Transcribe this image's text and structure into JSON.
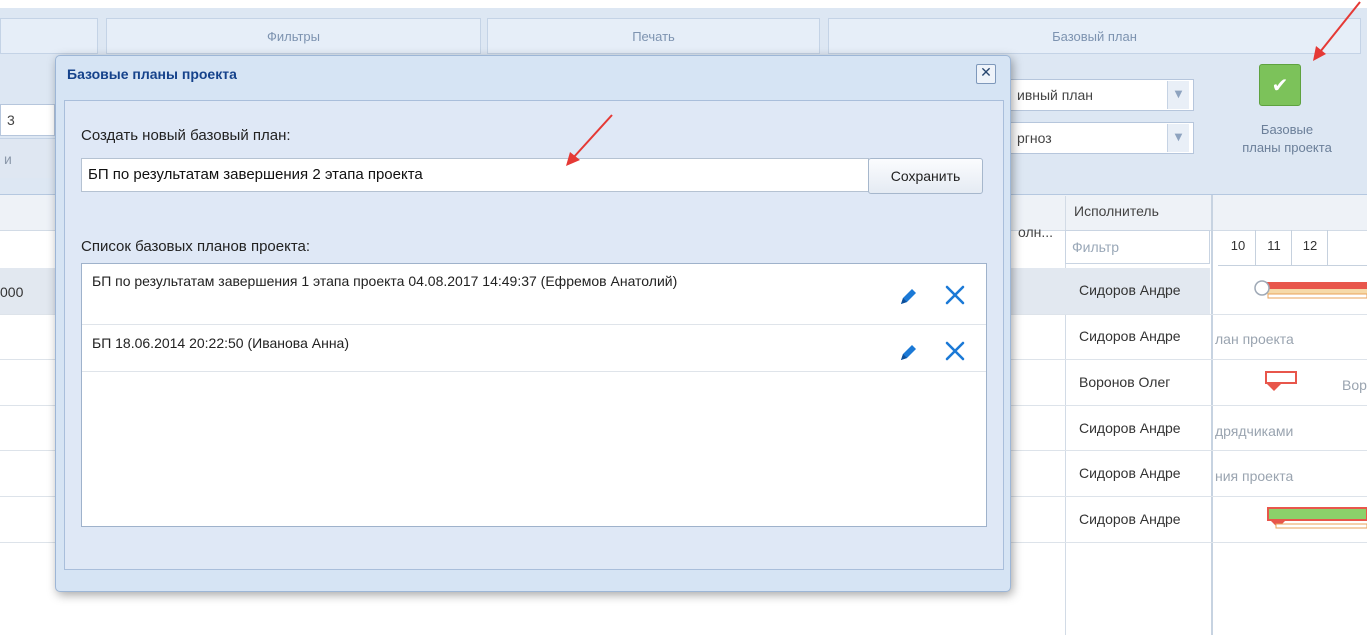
{
  "ribbon": {
    "tabs": [
      "Фильтры",
      "Печать",
      "Базовый план"
    ],
    "left_field_value": "3",
    "left_field_sub": "и",
    "plan_select": "ивный план",
    "forecast_select": "ргноз",
    "baselines_button": {
      "line1": "Базовые",
      "line2": "планы проекта"
    }
  },
  "grid": {
    "row_stub": "000",
    "completion_header": "олн...",
    "performer_header": "Исполнитель",
    "filter_placeholder": "Фильтр",
    "days": [
      "10",
      "11",
      "12"
    ],
    "performers": [
      "Сидоров Андре",
      "Сидоров Андре",
      "Воронов Олег",
      "Сидоров Андре",
      "Сидоров Андре",
      "Сидоров Андре"
    ],
    "gantt_texts": [
      "лан проекта",
      "Вор",
      "дрядчиками",
      "ния проекта"
    ]
  },
  "dialog": {
    "title": "Базовые планы проекта",
    "close_glyph": "✕",
    "create_label": "Создать новый базовый план:",
    "new_name_value": "БП по результатам завершения 2 этапа проекта",
    "save_label": "Сохранить",
    "list_label": "Список базовых планов проекта:",
    "baselines": [
      "БП по результатам завершения 1 этапа проекта 04.08.2017 14:49:37 (Ефремов Анатолий)",
      "БП 18.06.2014 20:22:50 (Иванова Анна)"
    ]
  },
  "colors": {
    "accent_blue": "#15428b",
    "dialog_bg": "#dfe8f6",
    "icon_blue": "#1b79d6",
    "success_green": "#7cc25a",
    "arrow_red": "#e53935"
  },
  "icons": {
    "edit": "pencil-icon",
    "delete": "close-icon",
    "baselines": "check-icon",
    "dropdown": "chevron-down-icon"
  }
}
